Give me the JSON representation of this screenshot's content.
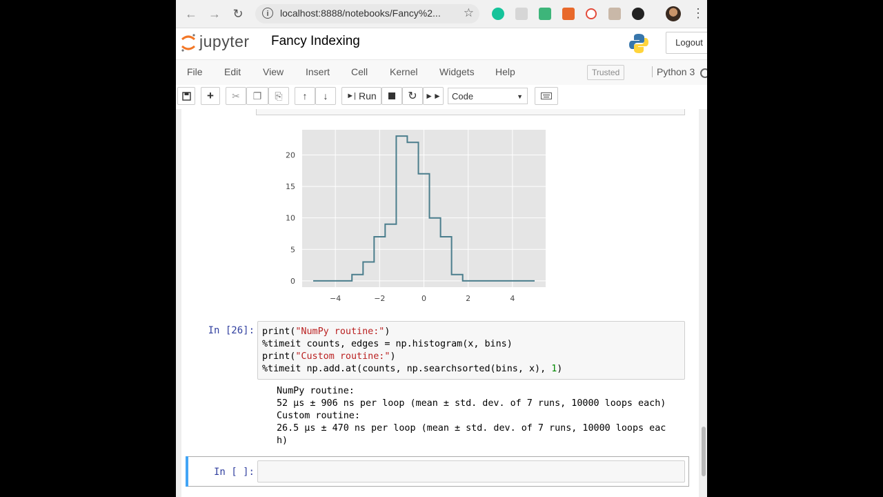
{
  "browser": {
    "url": "localhost:8888/notebooks/Fancy%2...",
    "back_icon": "arrow-left-icon",
    "forward_icon": "arrow-right-icon",
    "reload_icon": "reload-icon"
  },
  "header": {
    "logo_text": "jupyter",
    "notebook_title": "Fancy Indexing",
    "logout_label": "Logout"
  },
  "menubar": {
    "items": [
      "File",
      "Edit",
      "View",
      "Insert",
      "Cell",
      "Kernel",
      "Widgets",
      "Help"
    ],
    "trusted": "Trusted",
    "kernel_name": "Python 3"
  },
  "toolbar": {
    "run_label": "Run",
    "cell_type": "Code"
  },
  "chart_data": {
    "type": "line",
    "drawstyle": "steps",
    "x": [
      -5.0,
      -4.5,
      -4.0,
      -3.5,
      -3.0,
      -2.5,
      -2.0,
      -1.5,
      -1.0,
      -0.5,
      0.0,
      0.5,
      1.0,
      1.5,
      2.0,
      2.5,
      3.0,
      3.5,
      4.0,
      4.5,
      5.0
    ],
    "y": [
      0,
      0,
      0,
      0,
      1,
      3,
      7,
      9,
      23,
      22,
      17,
      10,
      7,
      1,
      0,
      0,
      0,
      0,
      0,
      0,
      0
    ],
    "xticks": [
      "-4",
      "-2",
      "0",
      "2",
      "4"
    ],
    "yticks": [
      "0",
      "5",
      "10",
      "15",
      "20"
    ],
    "xlim": [
      -5.5,
      5.5
    ],
    "ylim": [
      -1,
      24
    ],
    "grid": true,
    "colors": {
      "line": "#4a7d8c",
      "plot_bg": "#e5e5e5",
      "grid": "#ffffff"
    }
  },
  "cell26": {
    "prompt": "In [26]:",
    "lines": [
      [
        {
          "t": "print(",
          "c": ""
        },
        {
          "t": "\"NumPy routine:\"",
          "c": "str"
        },
        {
          "t": ")",
          "c": ""
        }
      ],
      [
        {
          "t": "%timeit counts, edges = np.histogram(x, bins)",
          "c": ""
        }
      ],
      [
        {
          "t": "print(",
          "c": ""
        },
        {
          "t": "\"Custom routine:\"",
          "c": "str"
        },
        {
          "t": ")",
          "c": ""
        }
      ],
      [
        {
          "t": "%timeit np.add.at(counts, np.searchsorted(bins, x), ",
          "c": ""
        },
        {
          "t": "1",
          "c": "num"
        },
        {
          "t": ")",
          "c": ""
        }
      ]
    ],
    "output": [
      "NumPy routine:",
      "52 µs ± 906 ns per loop (mean ± std. dev. of 7 runs, 10000 loops each)",
      "Custom routine:",
      "26.5 µs ± 470 ns per loop (mean ± std. dev. of 7 runs, 10000 loops eac",
      "h)"
    ]
  },
  "empty_cell": {
    "prompt": "In [ ]:"
  }
}
